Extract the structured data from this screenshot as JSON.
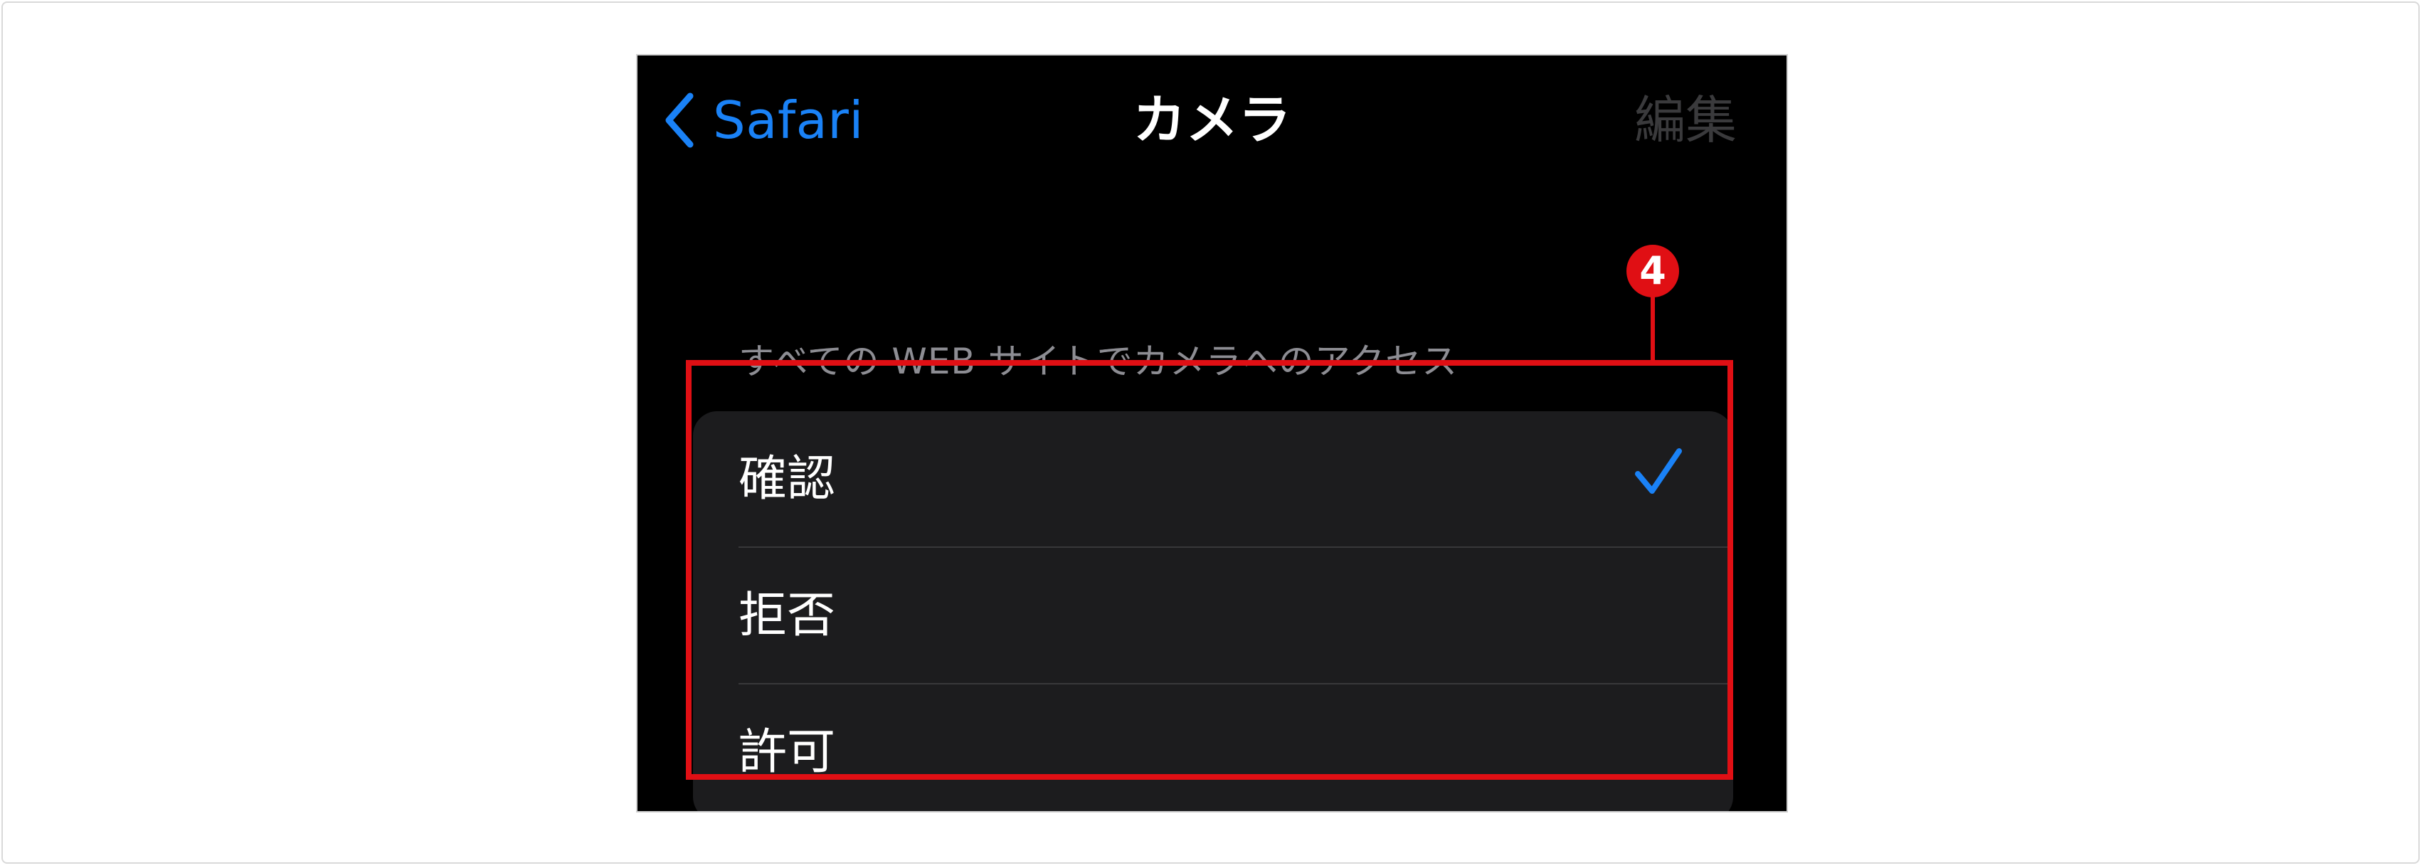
{
  "nav": {
    "back_label": "Safari",
    "back_icon": "chevron-left-icon",
    "title": "カメラ",
    "edit_label": "編集"
  },
  "section": {
    "header": "すべての WEB サイトでカメラへのアクセス"
  },
  "options": [
    {
      "label": "確認",
      "selected": true
    },
    {
      "label": "拒否",
      "selected": false
    },
    {
      "label": "許可",
      "selected": false
    }
  ],
  "annotation": {
    "callout_number": "4"
  },
  "colors": {
    "accent": "#1a82f7",
    "background": "#000000",
    "group_background": "#1c1c1e",
    "section_header": "#8d8d93",
    "disabled": "#3a3a3c",
    "annotation_red": "#e00f14"
  }
}
